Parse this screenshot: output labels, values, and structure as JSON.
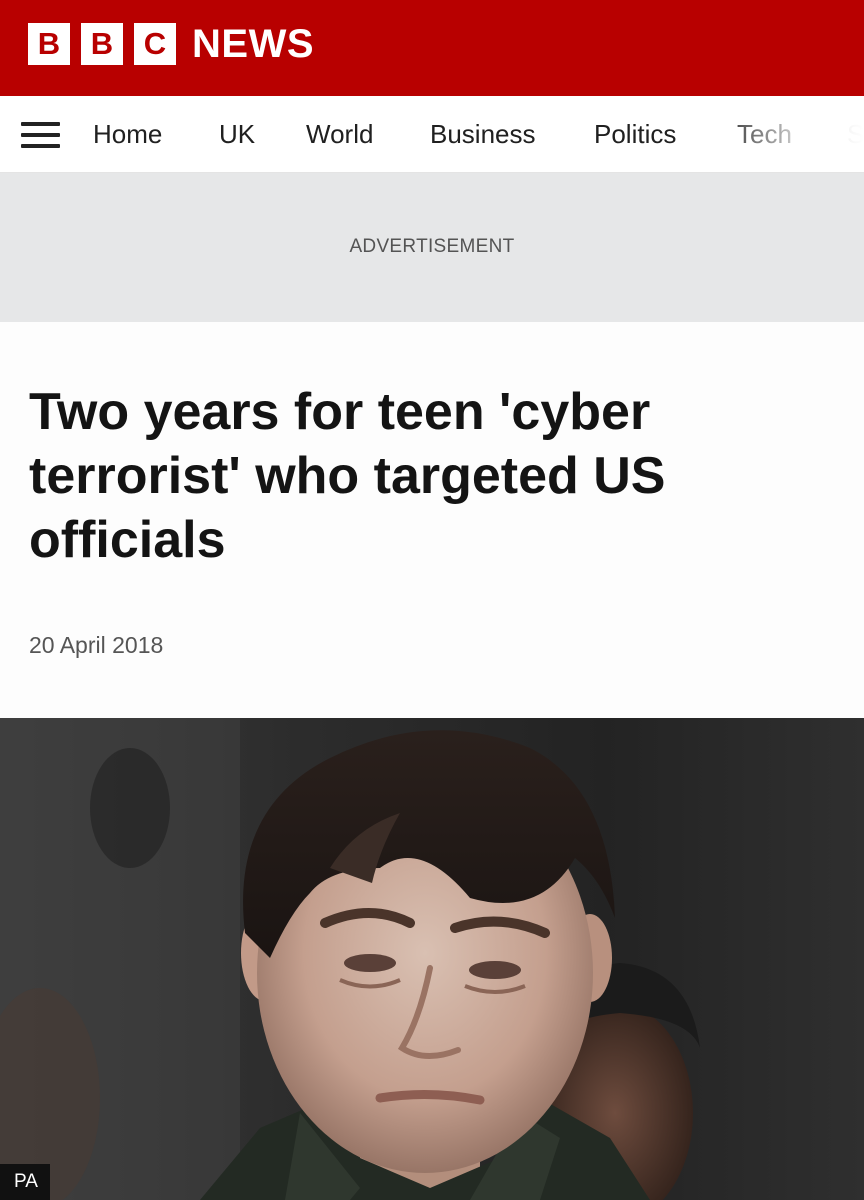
{
  "masthead": {
    "logo_letters": [
      "B",
      "B",
      "C"
    ],
    "logo_text": "NEWS",
    "brand_color": "#b80000"
  },
  "nav": {
    "menu_icon": "hamburger-menu-icon",
    "items": [
      {
        "label": "Home"
      },
      {
        "label": "UK"
      },
      {
        "label": "World"
      },
      {
        "label": "Business"
      },
      {
        "label": "Politics"
      },
      {
        "label": "Tech"
      },
      {
        "label": "S"
      }
    ]
  },
  "ad": {
    "label": "ADVERTISEMENT"
  },
  "article": {
    "headline": "Two years for teen 'cyber terrorist' who targeted US officials",
    "date": "20 April 2018",
    "image": {
      "credit": "PA"
    }
  }
}
